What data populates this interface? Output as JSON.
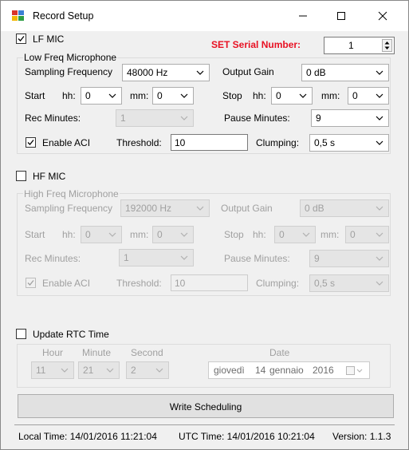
{
  "window": {
    "title": "Record Setup",
    "minimize": "—",
    "maximize": "☐",
    "close": "✕"
  },
  "serial": {
    "label": "SET Serial Number:",
    "value": "1",
    "label_color": "#e81123"
  },
  "lf": {
    "checkbox_label": "LF MIC",
    "checked": true,
    "group_title": "Low Freq Microphone",
    "sampling_label": "Sampling Frequency",
    "sampling_value": "48000 Hz",
    "gain_label": "Output Gain",
    "gain_value": "0 dB",
    "start_label": "Start",
    "hh_label": "hh:",
    "mm_label": "mm:",
    "start_hh": "0",
    "start_mm": "0",
    "stop_label": "Stop",
    "stop_hh": "0",
    "stop_mm": "0",
    "rec_label": "Rec Minutes:",
    "rec_value": "1",
    "pause_label": "Pause Minutes:",
    "pause_value": "9",
    "aci_label": "Enable ACI",
    "aci_checked": true,
    "threshold_label": "Threshold:",
    "threshold_value": "10",
    "clumping_label": "Clumping:",
    "clumping_value": "0,5 s"
  },
  "hf": {
    "checkbox_label": "HF MIC",
    "checked": false,
    "group_title": "High Freq Microphone",
    "sampling_label": "Sampling Frequency",
    "sampling_value": "192000 Hz",
    "gain_label": "Output Gain",
    "gain_value": "0 dB",
    "start_label": "Start",
    "hh_label": "hh:",
    "mm_label": "mm:",
    "start_hh": "0",
    "start_mm": "0",
    "stop_label": "Stop",
    "stop_hh": "0",
    "stop_mm": "0",
    "rec_label": "Rec Minutes:",
    "rec_value": "1",
    "pause_label": "Pause Minutes:",
    "pause_value": "9",
    "aci_label": "Enable ACI",
    "aci_checked": true,
    "threshold_label": "Threshold:",
    "threshold_value": "10",
    "clumping_label": "Clumping:",
    "clumping_value": "0,5 s"
  },
  "rtc": {
    "checkbox_label": "Update RTC Time",
    "checked": false,
    "hour_label": "Hour",
    "minute_label": "Minute",
    "second_label": "Second",
    "date_label": "Date",
    "hour_value": "11",
    "minute_value": "21",
    "second_value": "2",
    "date_weekday": "giovedì",
    "date_day": "14",
    "date_month": "gennaio",
    "date_year": "2016"
  },
  "write_button": "Write Scheduling",
  "status": {
    "local": "Local Time: 14/01/2016 11:21:04",
    "utc": "UTC Time: 14/01/2016 10:21:04",
    "version": "Version: 1.1.3"
  },
  "icons": {
    "app": "app-icon",
    "dropdown": "chevron-down-icon",
    "spinner": "spinner-arrows-icon",
    "check": "checkmark-icon",
    "calendar": "calendar-icon"
  }
}
